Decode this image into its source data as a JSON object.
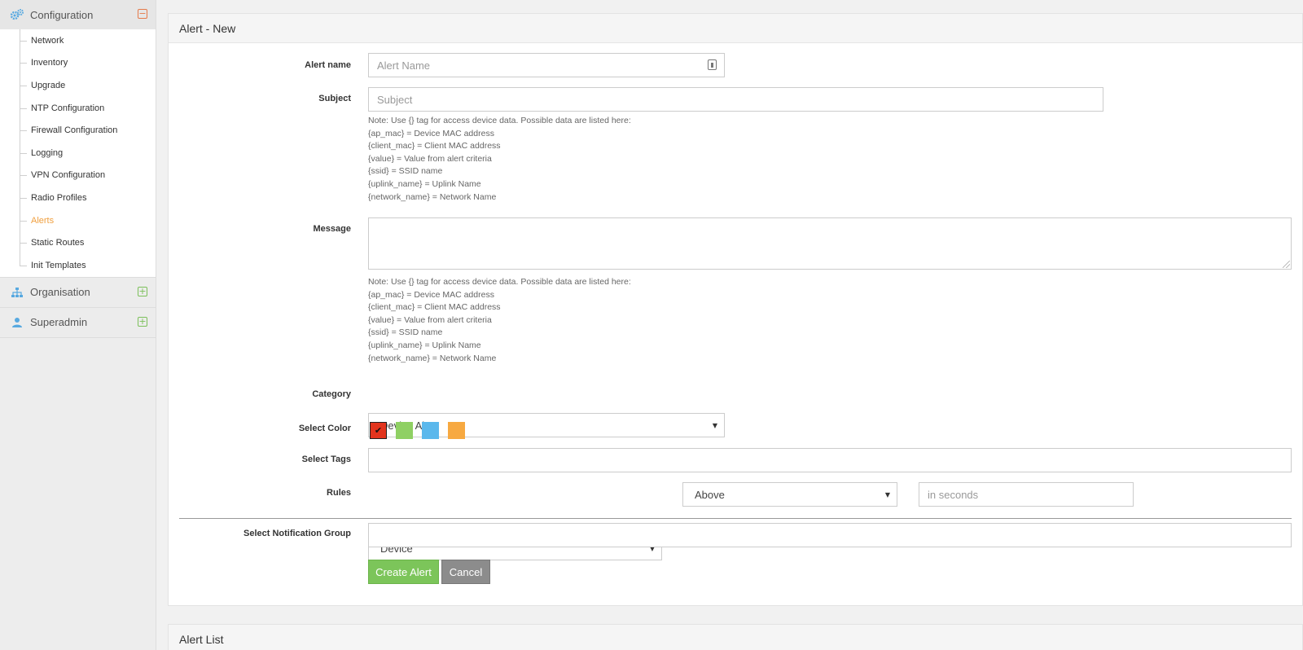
{
  "sidebar": {
    "configuration": {
      "title": "Configuration",
      "items": [
        {
          "label": "Network"
        },
        {
          "label": "Inventory"
        },
        {
          "label": "Upgrade"
        },
        {
          "label": "NTP Configuration"
        },
        {
          "label": "Firewall Configuration"
        },
        {
          "label": "Logging"
        },
        {
          "label": "VPN Configuration"
        },
        {
          "label": "Radio Profiles"
        },
        {
          "label": "Alerts"
        },
        {
          "label": "Static Routes"
        },
        {
          "label": "Init Templates"
        }
      ]
    },
    "organisation": {
      "title": "Organisation"
    },
    "superadmin": {
      "title": "Superadmin"
    }
  },
  "form": {
    "title": "Alert - New",
    "alert_name": {
      "label": "Alert name",
      "placeholder": "Alert Name",
      "value": ""
    },
    "subject": {
      "label": "Subject",
      "placeholder": "Subject",
      "value": ""
    },
    "note_lines": [
      "Note: Use {} tag for access device data. Possible data are listed here:",
      "{ap_mac} = Device MAC address",
      "{client_mac} = Client MAC address",
      "{value} = Value from alert criteria",
      "{ssid} = SSID name",
      "{uplink_name} = Uplink Name",
      "{network_name} = Network Name"
    ],
    "message": {
      "label": "Message",
      "value": ""
    },
    "category": {
      "label": "Category",
      "selected": "Device Alert"
    },
    "select_color": {
      "label": "Select Color",
      "colors": [
        "#e2341d",
        "#8fd063",
        "#5bb8ec",
        "#f7a941"
      ],
      "selected_index": 0,
      "check_glyph": "✔"
    },
    "select_tags": {
      "label": "Select Tags",
      "value": ""
    },
    "rules": {
      "label": "Rules",
      "subject_selected": "Device",
      "operator_selected": "Above",
      "seconds_placeholder": "in seconds"
    },
    "notification_group": {
      "label": "Select Notification Group",
      "value": ""
    },
    "buttons": {
      "create": "Create Alert",
      "cancel": "Cancel"
    }
  },
  "alert_list": {
    "title": "Alert List"
  }
}
